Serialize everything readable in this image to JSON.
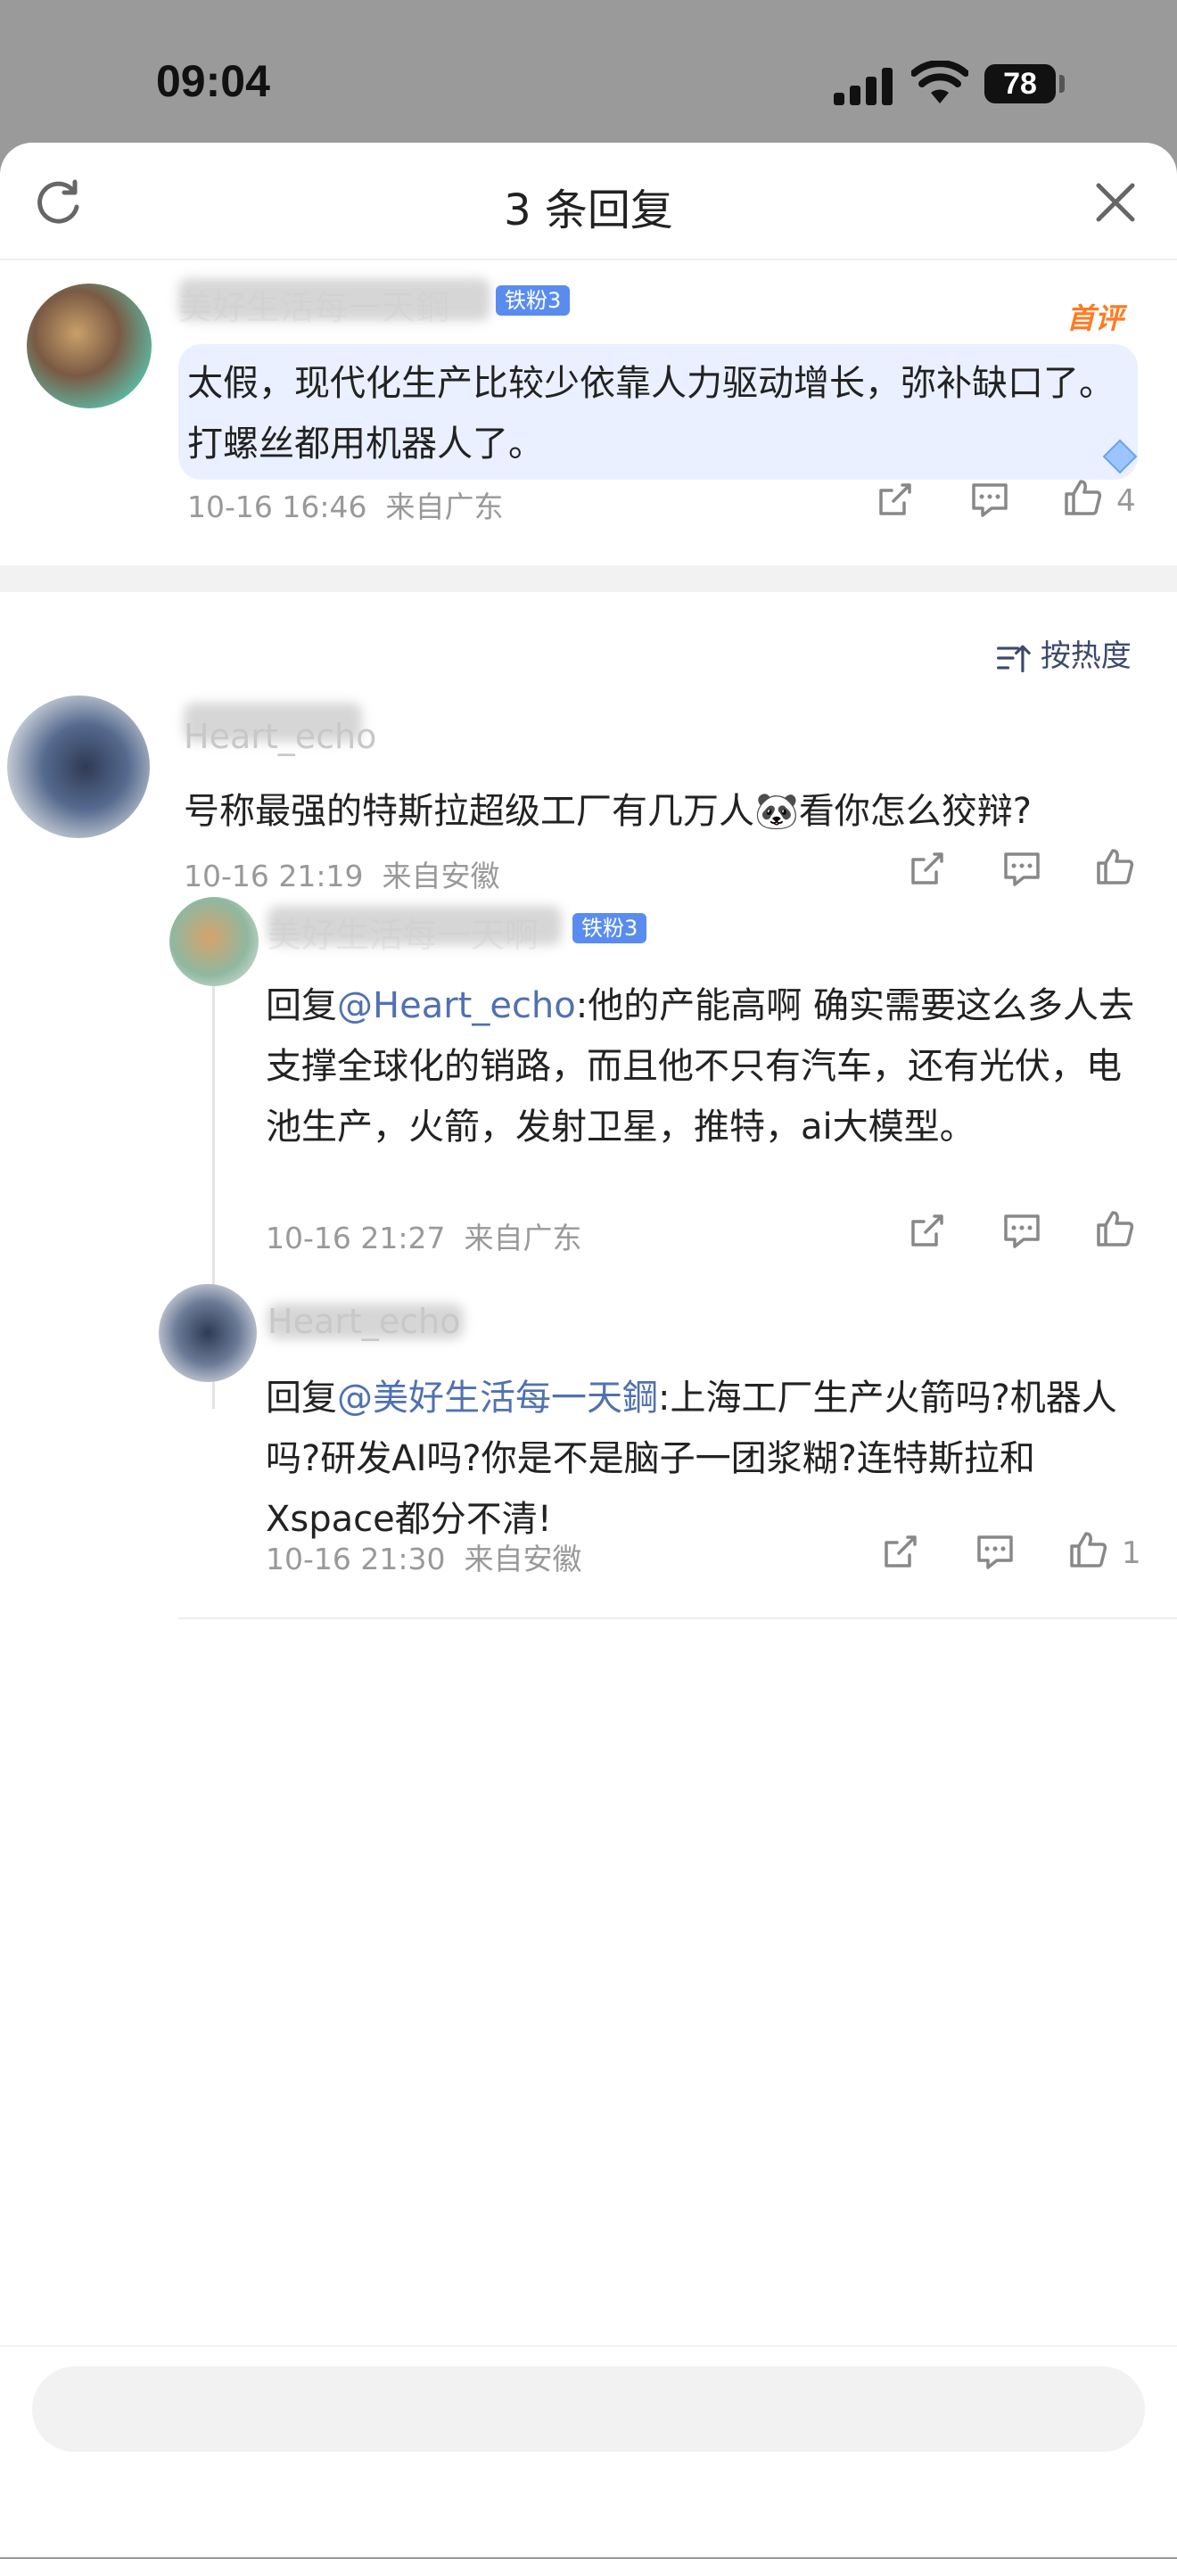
{
  "status_bar": {
    "time": "09:04",
    "battery": "78"
  },
  "header": {
    "title": "3 条回复"
  },
  "comments": [
    {
      "author": "美好生活每一天鋼",
      "badge": "铁粉3",
      "tag": "首评",
      "text": "太假，现代化生产比较少依靠人力驱动增长，弥补缺口了。打螺丝都用机器人了。",
      "time": "10-16 16:46",
      "location": "来自广东",
      "likes": "4"
    }
  ],
  "sort": {
    "label": "按热度"
  },
  "replies": [
    {
      "author": "Heart_echo",
      "text": "号称最强的特斯拉超级工厂有几万人",
      "emoji": "🐼",
      "text_after": "看你怎么狡辩?",
      "time": "10-16 21:19",
      "location": "来自安徽"
    },
    {
      "author": "美好生活每一天啊",
      "badge": "铁粉3",
      "reply_prefix": "回复",
      "mention": "@Heart_echo",
      "text": ":他的产能高啊 确实需要这么多人去支撑全球化的销路，而且他不只有汽车，还有光伏，电池生产，火箭，发射卫星，推特，ai大模型。",
      "time": "10-16 21:27",
      "location": "来自广东"
    },
    {
      "author": "Heart_echo",
      "reply_prefix": "回复",
      "mention": "@美好生活每一天鋼",
      "text": ":上海工厂生产火箭吗?机器人吗?研发AI吗?你是不是脑子一团浆糊?连特斯拉和Xspace都分不清!",
      "time": "10-16 21:30",
      "location": "来自安徽",
      "likes": "1"
    }
  ],
  "colors": {
    "accent": "#5a8cf0",
    "mention": "#5071b2",
    "first_tag": "#ff7a20"
  },
  "icons": [
    "refresh-icon",
    "close-icon",
    "share-icon",
    "reply-icon",
    "like-icon",
    "sort-icon"
  ]
}
